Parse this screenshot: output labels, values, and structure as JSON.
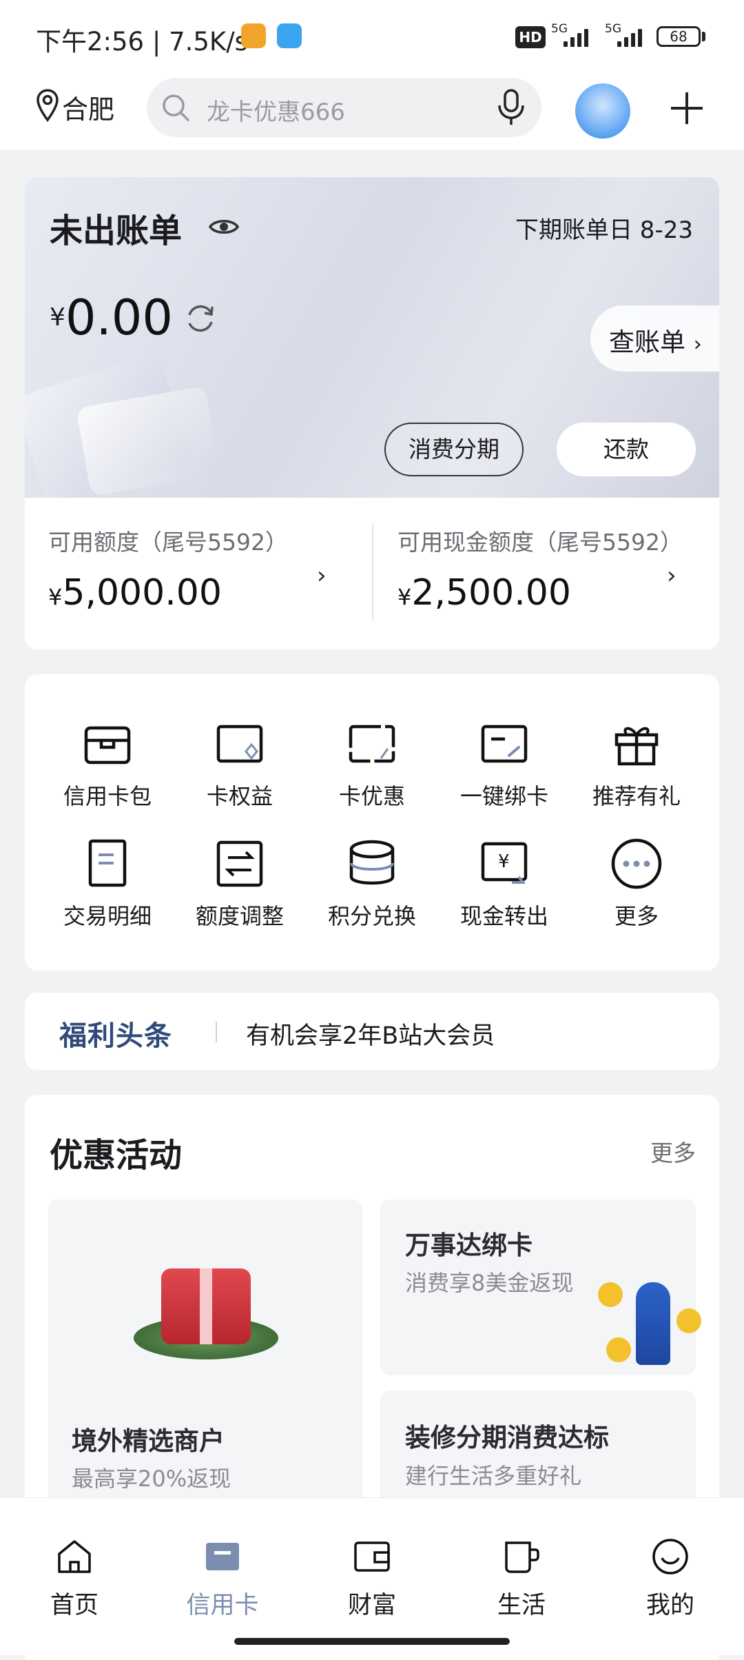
{
  "status_bar": {
    "time": "下午2:56",
    "net_speed": "| 7.5K/s",
    "hd": "HD",
    "sim1": "5G",
    "sim2": "5G",
    "battery": "68"
  },
  "header": {
    "location_icon": "location-pin-icon",
    "city": "合肥",
    "search_placeholder": "龙卡优惠666",
    "mic_icon": "microphone-icon",
    "avatar": "assistant-avatar",
    "add_icon": "plus-icon"
  },
  "bill": {
    "title": "未出账单",
    "due_label": "下期账单日  8-23",
    "currency": "¥",
    "amount": "0.00",
    "view_bill": "查账单",
    "installment": "消费分期",
    "repay": "还款"
  },
  "limits": [
    {
      "label": "可用额度（尾号5592）",
      "currency": "¥",
      "value": "5,000.00"
    },
    {
      "label": "可用现金额度（尾号5592）",
      "currency": "¥",
      "value": "2,500.00"
    }
  ],
  "grid": [
    {
      "label": "信用卡包",
      "icon": "card-wallet-icon"
    },
    {
      "label": "卡权益",
      "icon": "card-rights-icon"
    },
    {
      "label": "卡优惠",
      "icon": "card-discount-icon"
    },
    {
      "label": "一键绑卡",
      "icon": "card-bind-icon"
    },
    {
      "label": "推荐有礼",
      "icon": "gift-icon"
    },
    {
      "label": "交易明细",
      "icon": "transaction-detail-icon"
    },
    {
      "label": "额度调整",
      "icon": "limit-adjust-icon"
    },
    {
      "label": "积分兑换",
      "icon": "points-exchange-icon"
    },
    {
      "label": "现金转出",
      "icon": "cash-transfer-icon"
    },
    {
      "label": "更多",
      "icon": "more-icon"
    }
  ],
  "welfare": {
    "tag": "福利头条",
    "text": "有机会享2年B站大会员"
  },
  "promotions": {
    "title": "优惠活动",
    "more": "更多",
    "cards": [
      {
        "title": "境外精选商户",
        "subtitle": "最高享20%返现"
      },
      {
        "title": "万事达绑卡",
        "subtitle": "消费享8美金返现"
      },
      {
        "title": "装修分期消费达标",
        "subtitle": "建行生活多重好礼"
      }
    ]
  },
  "nav": [
    {
      "label": "首页",
      "icon": "home-icon"
    },
    {
      "label": "信用卡",
      "icon": "credit-card-icon",
      "active": true
    },
    {
      "label": "财富",
      "icon": "wallet-icon"
    },
    {
      "label": "生活",
      "icon": "cup-icon"
    },
    {
      "label": "我的",
      "icon": "profile-smile-icon"
    }
  ],
  "colors": {
    "accent_nav_active": "#7c8db0",
    "welfare_tag": "#2f4a7a",
    "background": "#f1f2f4"
  }
}
